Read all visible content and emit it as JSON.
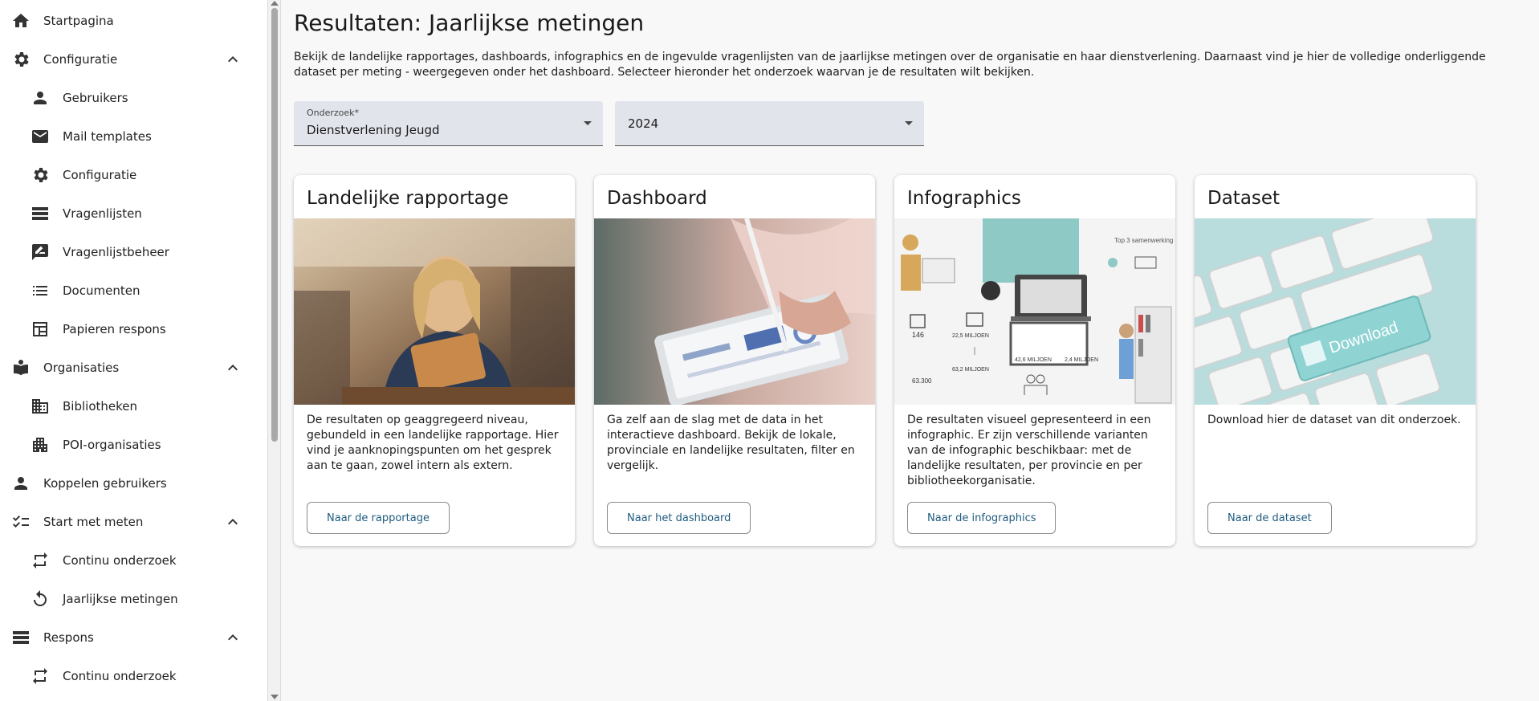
{
  "sidebar": {
    "items": [
      {
        "label": "Startpagina"
      },
      {
        "label": "Configuratie"
      },
      {
        "label": "Gebruikers"
      },
      {
        "label": "Mail templates"
      },
      {
        "label": "Configuratie"
      },
      {
        "label": "Vragenlijsten"
      },
      {
        "label": "Vragenlijstbeheer"
      },
      {
        "label": "Documenten"
      },
      {
        "label": "Papieren respons"
      },
      {
        "label": "Organisaties"
      },
      {
        "label": "Bibliotheken"
      },
      {
        "label": "POI-organisaties"
      },
      {
        "label": "Koppelen gebruikers"
      },
      {
        "label": "Start met meten"
      },
      {
        "label": "Continu onderzoek"
      },
      {
        "label": "Jaarlijkse metingen"
      },
      {
        "label": "Respons"
      },
      {
        "label": "Continu onderzoek"
      }
    ]
  },
  "main": {
    "title": "Resultaten: Jaarlijkse metingen",
    "intro": "Bekijk de landelijke rapportages, dashboards, infographics en de ingevulde vragenlijsten van de jaarlijkse metingen over de organisatie en haar dienstverlening. Daarnaast vind je hier de volledige onderliggende dataset per meting - weergegeven onder het dashboard. Selecteer hieronder het onderzoek waarvan je de resultaten wilt bekijken.",
    "filters": {
      "onderzoek": {
        "label": "Onderzoek*",
        "value": "Dienstverlening Jeugd"
      },
      "jaar": {
        "value": "2024"
      }
    },
    "cards": [
      {
        "title": "Landelijke rapportage",
        "description": "De resultaten op geaggregeerd niveau, gebundeld in een landelijke rapportage. Hier vind je aanknopingspunten om het gesprek aan te gaan, zowel intern als extern.",
        "button": "Naar de rapportage"
      },
      {
        "title": "Dashboard",
        "description": "Ga zelf aan de slag met de data in het interactieve dashboard. Bekijk de lokale, provinciale en landelijke resultaten, filter en vergelijk.",
        "button": "Naar het dashboard"
      },
      {
        "title": "Infographics",
        "description": "De resultaten visueel gepresenteerd in een infographic. Er zijn verschillende varianten van de infographic beschikbaar: met de landelijke resultaten, per provincie en per bibliotheekorganisatie.",
        "button": "Naar de infographics"
      },
      {
        "title": "Dataset",
        "description": "Download hier de dataset van dit onderzoek.",
        "button": "Naar de dataset"
      }
    ],
    "infographic_texts": {
      "top3": "Top 3 samenwerking",
      "n146": "146",
      "m225": "22,5 MILJOEN",
      "m426": "42,6 MILJOEN",
      "m24": "2,4 MILJOEN",
      "n63300": "63.300",
      "m632": "63,2 MILJOEN"
    },
    "dataset_image_text": {
      "download": "Download"
    }
  },
  "colors": {
    "accent": "#1f5b7f",
    "field_bg": "#e2e4ec"
  }
}
